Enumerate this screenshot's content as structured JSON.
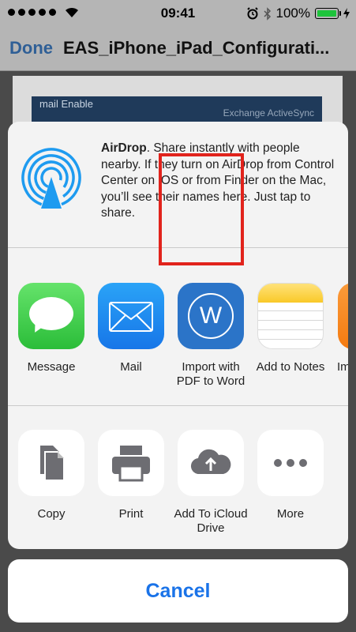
{
  "status_bar": {
    "time": "09:41",
    "battery": "100%"
  },
  "nav": {
    "done_label": "Done",
    "title": "EAS_iPhone_iPad_Configurati..."
  },
  "document": {
    "banner_left": "mail Enable",
    "banner_right": "Exchange ActiveSync"
  },
  "airdrop": {
    "title": "AirDrop",
    "text": ". Share instantly with people nearby. If they turn on AirDrop from Control Center on iOS or from Finder on the Mac, you’ll see their names here. Just tap to share."
  },
  "apps": [
    {
      "label": "Message",
      "icon": "messages-icon"
    },
    {
      "label": "Mail",
      "icon": "mail-icon"
    },
    {
      "label": "Import with PDF to Word",
      "icon": "pdf-to-word-icon"
    },
    {
      "label": "Add to Notes",
      "icon": "notes-icon"
    },
    {
      "label": "Im",
      "icon": "app-icon-partial"
    }
  ],
  "actions": [
    {
      "label": "Copy",
      "icon": "copy-icon"
    },
    {
      "label": "Print",
      "icon": "print-icon"
    },
    {
      "label": "Add To iCloud Drive",
      "icon": "icloud-upload-icon"
    },
    {
      "label": "More",
      "icon": "more-icon"
    }
  ],
  "colors": {
    "accent": "#1a73e8",
    "highlight": "#e1231c"
  },
  "cancel_label": "Cancel"
}
